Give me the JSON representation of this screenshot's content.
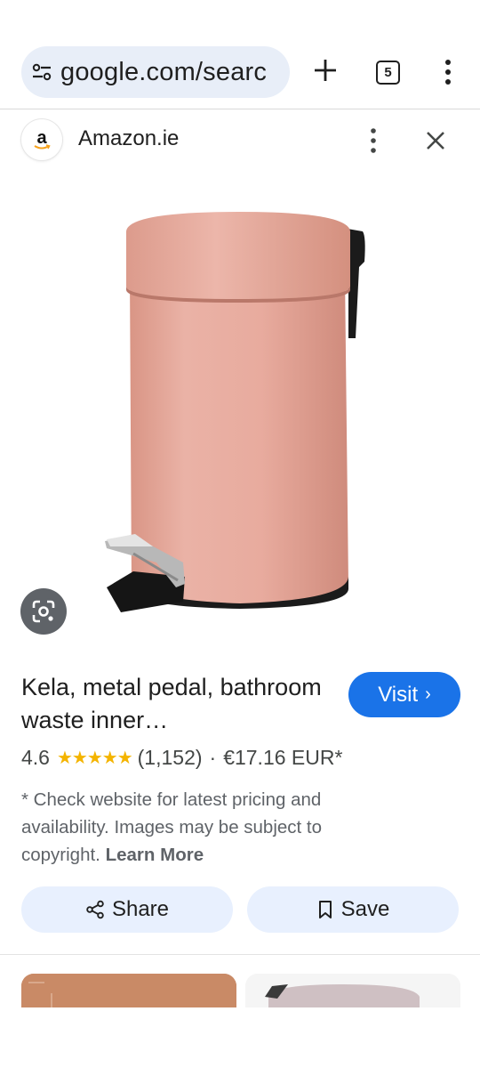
{
  "browser": {
    "url": "google.com/searc",
    "tab_count": "5"
  },
  "panel": {
    "site_logo_letter": "a",
    "site_name": "Amazon.ie"
  },
  "product": {
    "title": "Kela, metal pedal, bathroom waste inner…",
    "visit_label": "Visit",
    "visit_chevron": "›",
    "rating": "4.6",
    "stars": "★★★★★",
    "review_count": "(1,152)",
    "separator": "·",
    "price": "€17.16 EUR*",
    "disclaimer": "* Check website for latest pricing and availability. Images may be subject to copyright.",
    "learn_more": "Learn More"
  },
  "actions": {
    "share_label": "Share",
    "save_label": "Save"
  },
  "colors": {
    "accent": "#1a73e8",
    "chip_bg": "#e8f0fe",
    "bin_pink": "#e6a99d",
    "star": "#f4b400"
  },
  "icons": [
    "tune-icon",
    "plus-icon",
    "tab-switcher-icon",
    "more-vert-icon",
    "close-icon",
    "lens-icon",
    "share-icon",
    "bookmark-icon"
  ]
}
